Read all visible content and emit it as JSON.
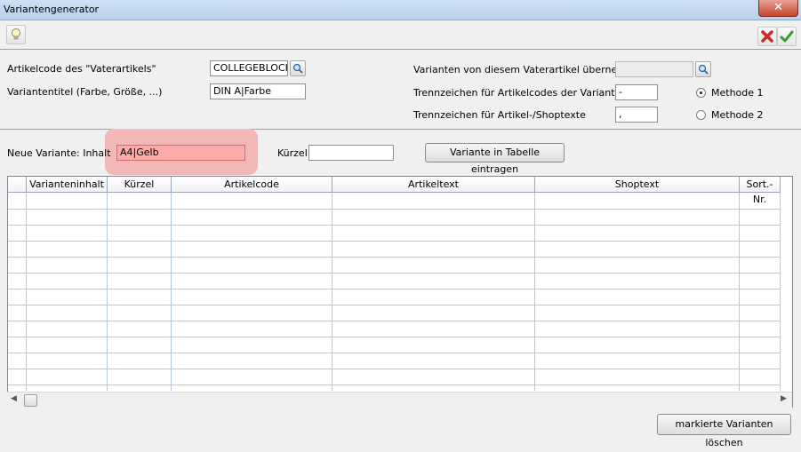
{
  "window": {
    "title": "Variantengenerator",
    "close_glyph": "✕"
  },
  "toolbar": {
    "tip_icon": "lightbulb-icon",
    "cancel_icon": "red-x-icon",
    "ok_icon": "green-check-icon"
  },
  "form": {
    "article_code_label": "Artikelcode des \"Vaterartikels\"",
    "article_code_value": "COLLEGEBLOCK",
    "variant_title_label": "Variantentitel (Farbe, Größe, ...)",
    "variant_title_value": "DIN A|Farbe",
    "copy_label": "Varianten von diesem Vaterartikel übernehmen",
    "copy_value": "",
    "sep_codes_label": "Trennzeichen für Artikelcodes der Varianten",
    "sep_codes_value": "-",
    "sep_texts_label": "Trennzeichen für Artikel-/Shoptexte",
    "sep_texts_value": ",",
    "method1_label": "Methode 1",
    "method2_label": "Methode 2",
    "selected_method": 1
  },
  "new_variant": {
    "content_label": "Neue Variante: Inhalt",
    "content_value": "A4|Gelb",
    "short_label": "Kürzel",
    "short_value": "",
    "add_button": "Variante in Tabelle eintragen"
  },
  "table": {
    "columns": [
      "Varianteninhalt",
      "Kürzel",
      "Artikelcode",
      "Artikeltext",
      "Shoptext",
      "Sort.-Nr."
    ],
    "rows": []
  },
  "footer": {
    "delete_button": "markierte Varianten löschen"
  }
}
